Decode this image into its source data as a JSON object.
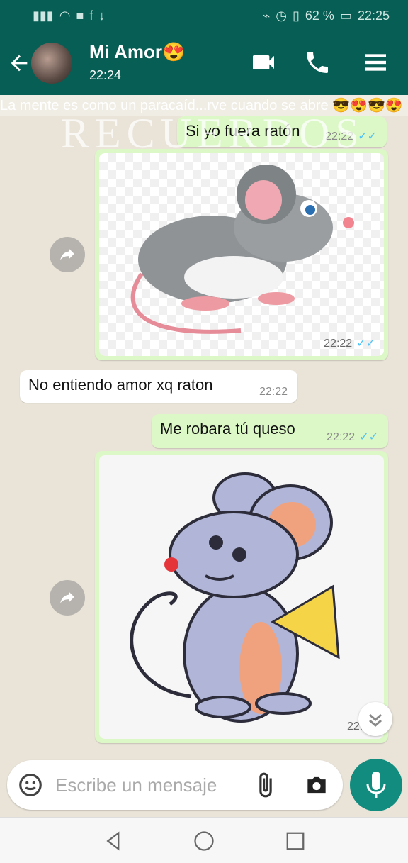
{
  "status_bar": {
    "battery": "62 %",
    "clock": "22:25"
  },
  "header": {
    "contact_name": "Mi Amor😍",
    "last_seen": "22:24"
  },
  "overlay": {
    "marquee": "La mente es como un paracaíd...rve cuando se abre 😎😍😎😍",
    "watermark": "RECUERDOS"
  },
  "messages": [
    {
      "type": "text",
      "dir": "out",
      "text": "Si yo fuera ratón",
      "time": "22:22"
    },
    {
      "type": "image",
      "dir": "out",
      "subject": "gray mouse sticker",
      "time": "22:22"
    },
    {
      "type": "text",
      "dir": "in",
      "text": "No entiendo amor xq raton",
      "time": "22:22"
    },
    {
      "type": "text",
      "dir": "out",
      "text": "Me robara tú queso",
      "time": "22:22"
    },
    {
      "type": "image",
      "dir": "out",
      "subject": "mouse with cheese sticker",
      "time": "22:22"
    }
  ],
  "composer": {
    "placeholder": "Escribe un mensaje"
  },
  "colors": {
    "header": "#075e54",
    "outgoing_bubble": "#dcf8c6",
    "incoming_bubble": "#ffffff",
    "read_ticks": "#4fc3f7",
    "mic_button": "#128c7e"
  },
  "icons": [
    "back-arrow-icon",
    "video-call-icon",
    "phone-icon",
    "menu-icon",
    "emoji-icon",
    "attach-icon",
    "camera-icon",
    "mic-icon",
    "share-icon",
    "scroll-down-icon"
  ]
}
